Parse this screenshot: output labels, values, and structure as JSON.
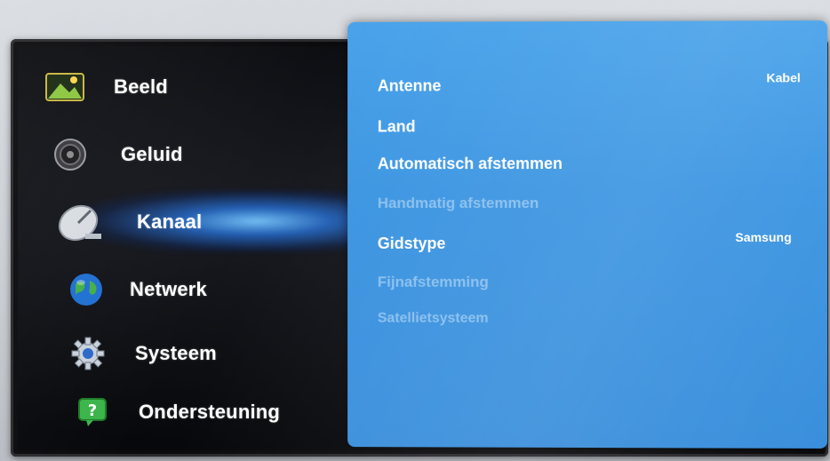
{
  "main_menu": {
    "items": [
      {
        "label": "Beeld",
        "icon": "picture-icon"
      },
      {
        "label": "Geluid",
        "icon": "speaker-icon"
      },
      {
        "label": "Kanaal",
        "icon": "satellite-dish-icon",
        "selected": true
      },
      {
        "label": "Netwerk",
        "icon": "globe-icon"
      },
      {
        "label": "Systeem",
        "icon": "gear-icon"
      },
      {
        "label": "Ondersteuning",
        "icon": "help-icon"
      }
    ]
  },
  "submenu": {
    "items": [
      {
        "label": "Antenne",
        "value": "Kabel",
        "enabled": true
      },
      {
        "label": "Land",
        "value": "",
        "enabled": true
      },
      {
        "label": "Automatisch afstemmen",
        "value": "",
        "enabled": true
      },
      {
        "label": "Handmatig afstemmen",
        "value": "",
        "enabled": false
      },
      {
        "label": "Gidstype",
        "value": "Samsung",
        "enabled": true
      },
      {
        "label": "Fijnafstemming",
        "value": "",
        "enabled": false
      },
      {
        "label": "Satellietsysteem",
        "value": "",
        "enabled": false
      }
    ]
  },
  "colors": {
    "panel_blue": "#3d96e2",
    "selection_glow": "#2f8ae8",
    "text_white": "#ffffff",
    "text_disabled": "#c8e4fa"
  }
}
